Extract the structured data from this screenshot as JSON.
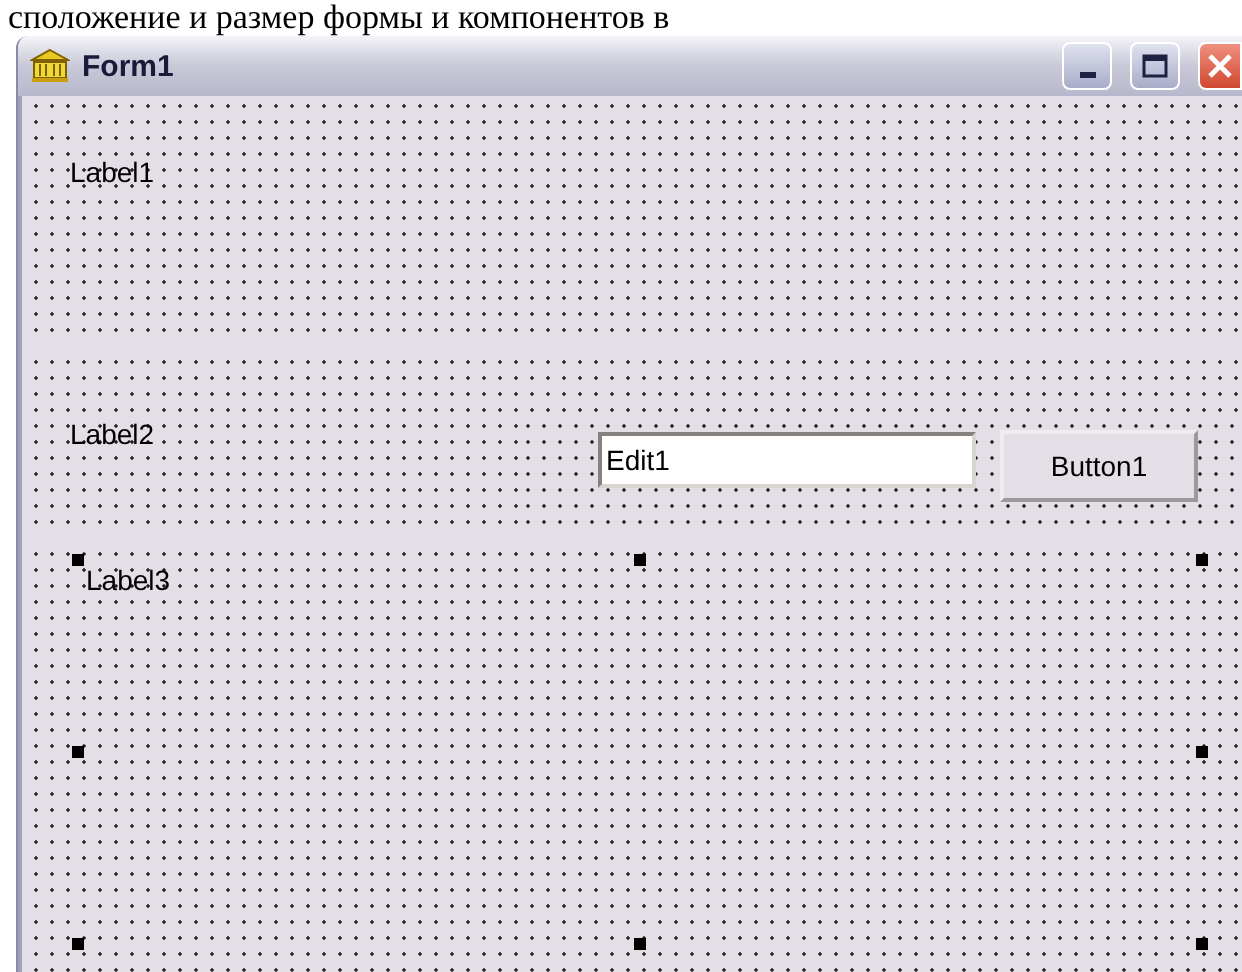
{
  "document_text": "сположение и размер формы и компонентов в",
  "window": {
    "title": "Form1"
  },
  "panels": [
    {
      "label": "Label1"
    },
    {
      "label": "Label2",
      "edit": {
        "value": "Edit1"
      },
      "button": "Button1"
    },
    {
      "label": "Label3",
      "selected": true
    }
  ]
}
